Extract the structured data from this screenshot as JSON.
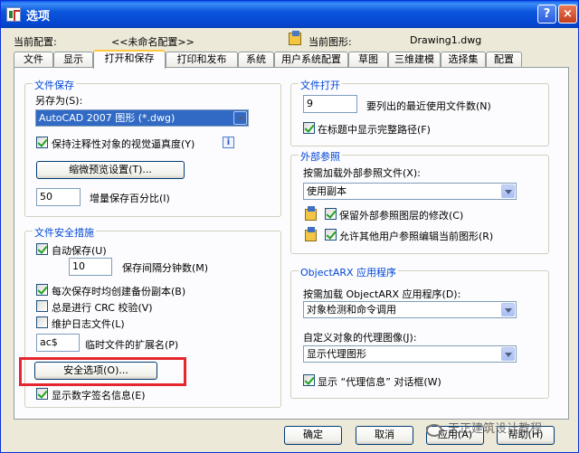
{
  "window": {
    "title": "选项",
    "help_button": "?",
    "close_button": "×"
  },
  "profile": {
    "label": "当前配置:",
    "value": "<<未命名配置>>",
    "drawing_label": "当前图形:",
    "drawing_value": "Drawing1.dwg"
  },
  "tabs": [
    "文件",
    "显示",
    "打开和保存",
    "打印和发布",
    "系统",
    "用户系统配置",
    "草图",
    "三维建模",
    "选择集",
    "配置"
  ],
  "active_tab": "打开和保存",
  "file_save": {
    "title": "文件保存",
    "save_as_label": "另存为(S):",
    "save_as_value": "AutoCAD 2007 图形 (*.dwg)",
    "annotative_label": "保持注释性对象的视觉逼真度(Y)",
    "annotative_checked": true,
    "info_icon": "i",
    "thumbnail_button": "缩微预览设置(T)...",
    "incremental_value": "50",
    "incremental_label": "增量保存百分比(I)"
  },
  "file_safety": {
    "title": "文件安全措施",
    "autosave_label": "自动保存(U)",
    "autosave_checked": true,
    "interval_value": "10",
    "interval_label": "保存间隔分钟数(M)",
    "backup_label": "每次保存时均创建备份副本(B)",
    "backup_checked": true,
    "crc_label": "总是进行 CRC 校验(V)",
    "crc_checked": false,
    "log_label": "维护日志文件(L)",
    "log_checked": false,
    "ext_value": "ac$",
    "ext_label": "临时文件的扩展名(P)",
    "security_button": "安全选项(O)...",
    "digsig_label": "显示数字签名信息(E)",
    "digsig_checked": true
  },
  "file_open": {
    "title": "文件打开",
    "recent_value": "9",
    "recent_label": "要列出的最近使用文件数(N)",
    "fullpath_label": "在标题中显示完整路径(F)",
    "fullpath_checked": true
  },
  "xref": {
    "title": "外部参照",
    "demand_label": "按需加载外部参照文件(X):",
    "demand_value": "使用副本",
    "retain_label": "保留外部参照图层的修改(C)",
    "retain_checked": true,
    "allow_label": "允许其他用户参照编辑当前图形(R)",
    "allow_checked": true
  },
  "objectarx": {
    "title": "ObjectARX 应用程序",
    "demand_label": "按需加载 ObjectARX 应用程序(D):",
    "demand_value": "对象检测和命令调用",
    "proxy_label": "自定义对象的代理图像(J):",
    "proxy_value": "显示代理图形",
    "proxy_info_label": "显示 “代理信息” 对话框(W)",
    "proxy_info_checked": true
  },
  "footer": {
    "ok": "确定",
    "cancel": "取消",
    "apply": "应用(A)",
    "help": "帮助(H)"
  },
  "watermark": "天正建筑设计教程",
  "colors": {
    "highlight": "#e5262e",
    "title_bar": "#0a56dd",
    "group_title": "#0046d5",
    "selection": "#316ac5"
  }
}
